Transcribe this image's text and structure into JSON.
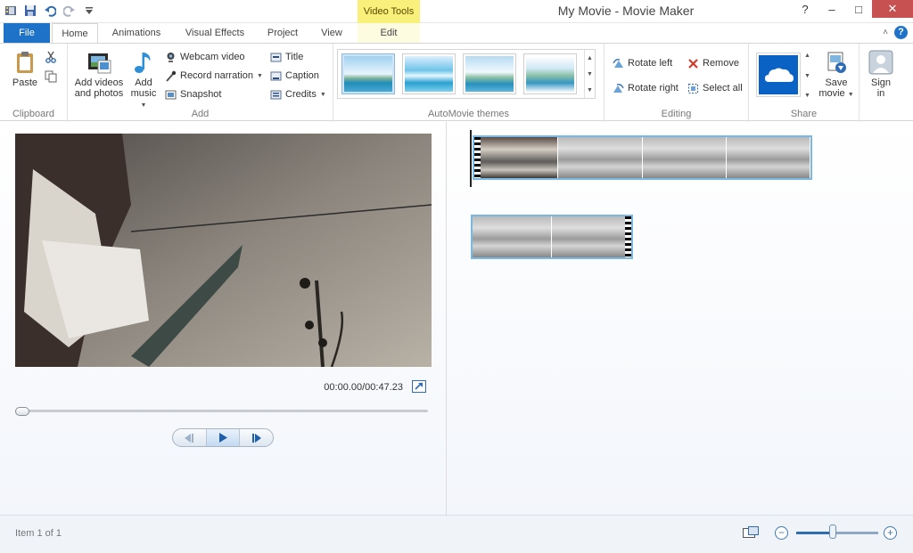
{
  "app": {
    "title": "My Movie - Movie Maker"
  },
  "contextual_tab_group": "Video Tools",
  "tabs": {
    "file": "File",
    "home": "Home",
    "animations": "Animations",
    "visual_effects": "Visual Effects",
    "project": "Project",
    "view": "View",
    "edit": "Edit"
  },
  "ribbon": {
    "clipboard": {
      "label": "Clipboard",
      "paste": "Paste"
    },
    "add": {
      "label": "Add",
      "add_videos_line1": "Add videos",
      "add_videos_line2": "and photos",
      "add_music_line1": "Add",
      "add_music_line2": "music",
      "webcam_video": "Webcam video",
      "record_narration": "Record narration",
      "snapshot": "Snapshot",
      "title": "Title",
      "caption": "Caption",
      "credits": "Credits"
    },
    "automovie": {
      "label": "AutoMovie themes",
      "theme_count": 4
    },
    "editing": {
      "label": "Editing",
      "rotate_left": "Rotate left",
      "rotate_right": "Rotate right",
      "remove": "Remove",
      "select_all": "Select all"
    },
    "share": {
      "label": "Share",
      "save_movie_line1": "Save",
      "save_movie_line2": "movie",
      "sign_in_line1": "Sign",
      "sign_in_line2": "in"
    }
  },
  "player": {
    "timecode": "00:00.00/00:47.23",
    "progress": 0
  },
  "status": {
    "item": "Item 1 of 1",
    "zoom_level": 0.45
  },
  "colors": {
    "file_tab": "#1e73c9",
    "context_tab": "#f8f07a",
    "clip_border": "#7ab8e4",
    "onedrive": "#0a62c4"
  }
}
